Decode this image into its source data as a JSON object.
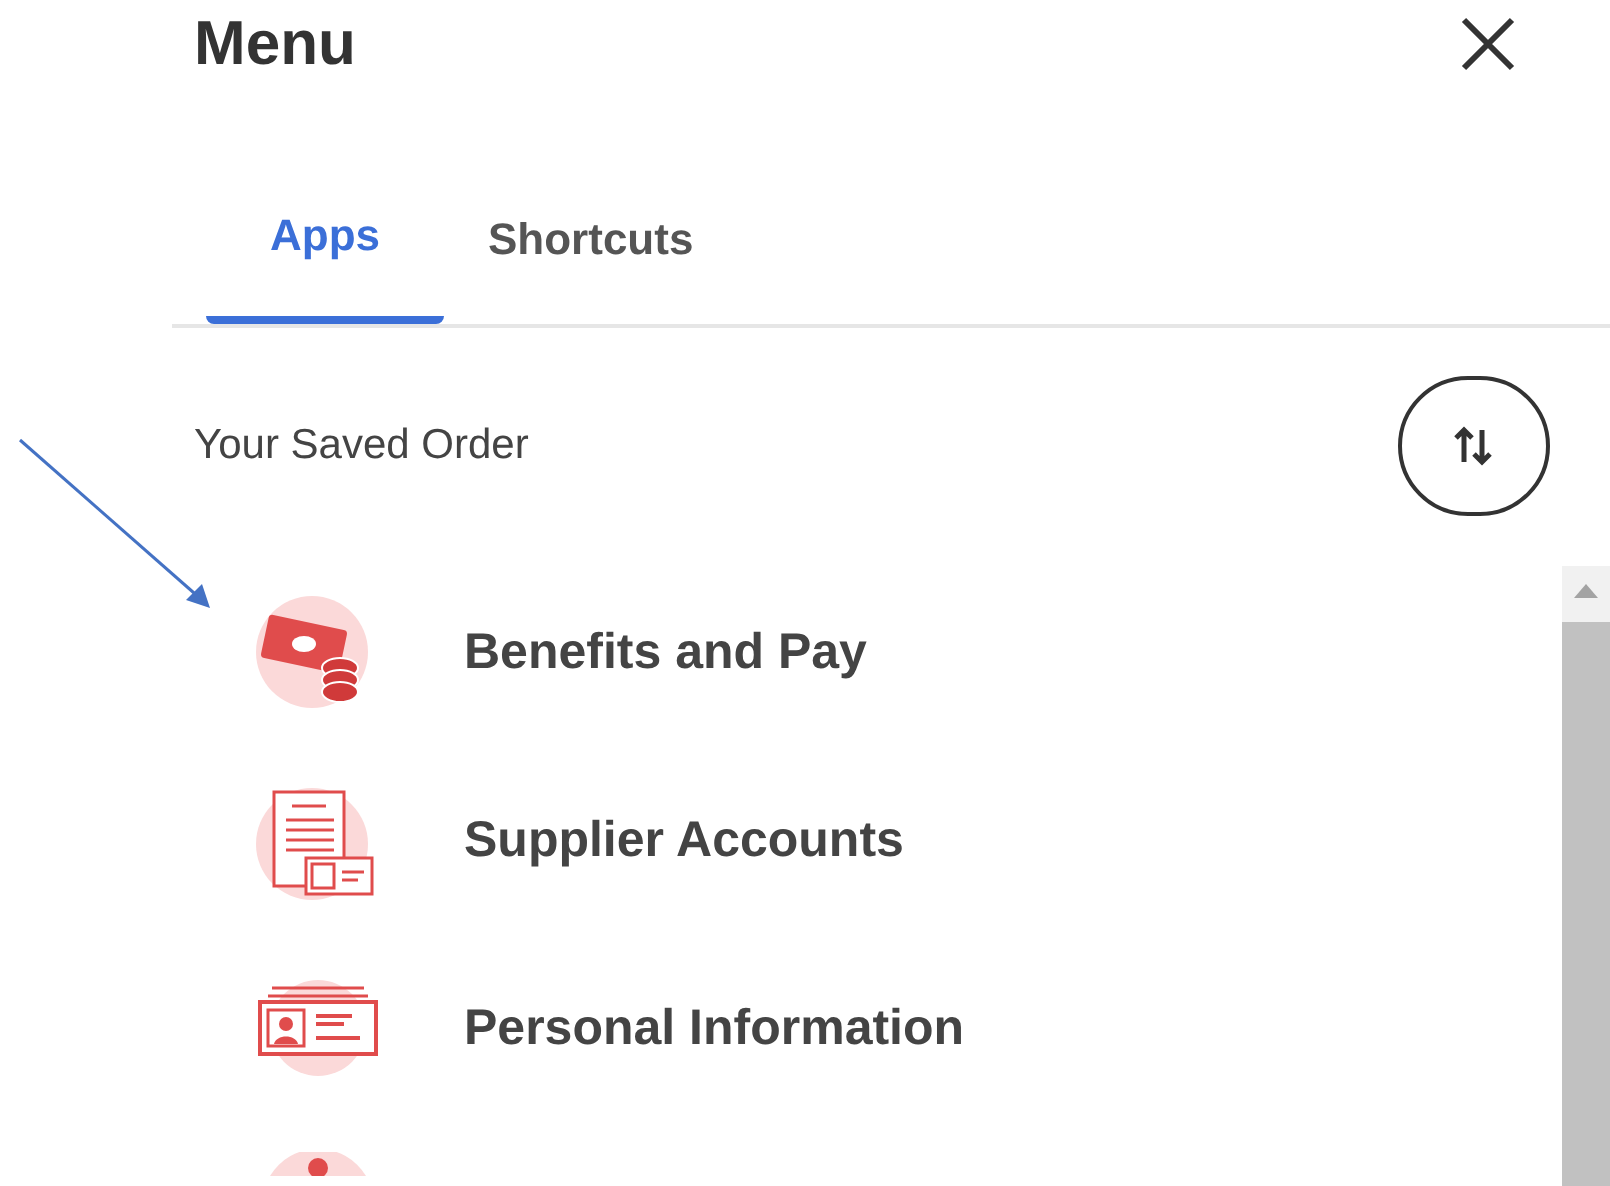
{
  "title": "Menu",
  "tabs": [
    {
      "label": "Apps",
      "selected": true
    },
    {
      "label": "Shortcuts",
      "selected": false
    }
  ],
  "section_label": "Your Saved Order",
  "apps": [
    {
      "label": "Benefits and Pay",
      "kind": "money"
    },
    {
      "label": "Supplier Accounts",
      "kind": "document"
    },
    {
      "label": "Personal Information",
      "kind": "idcard"
    }
  ]
}
